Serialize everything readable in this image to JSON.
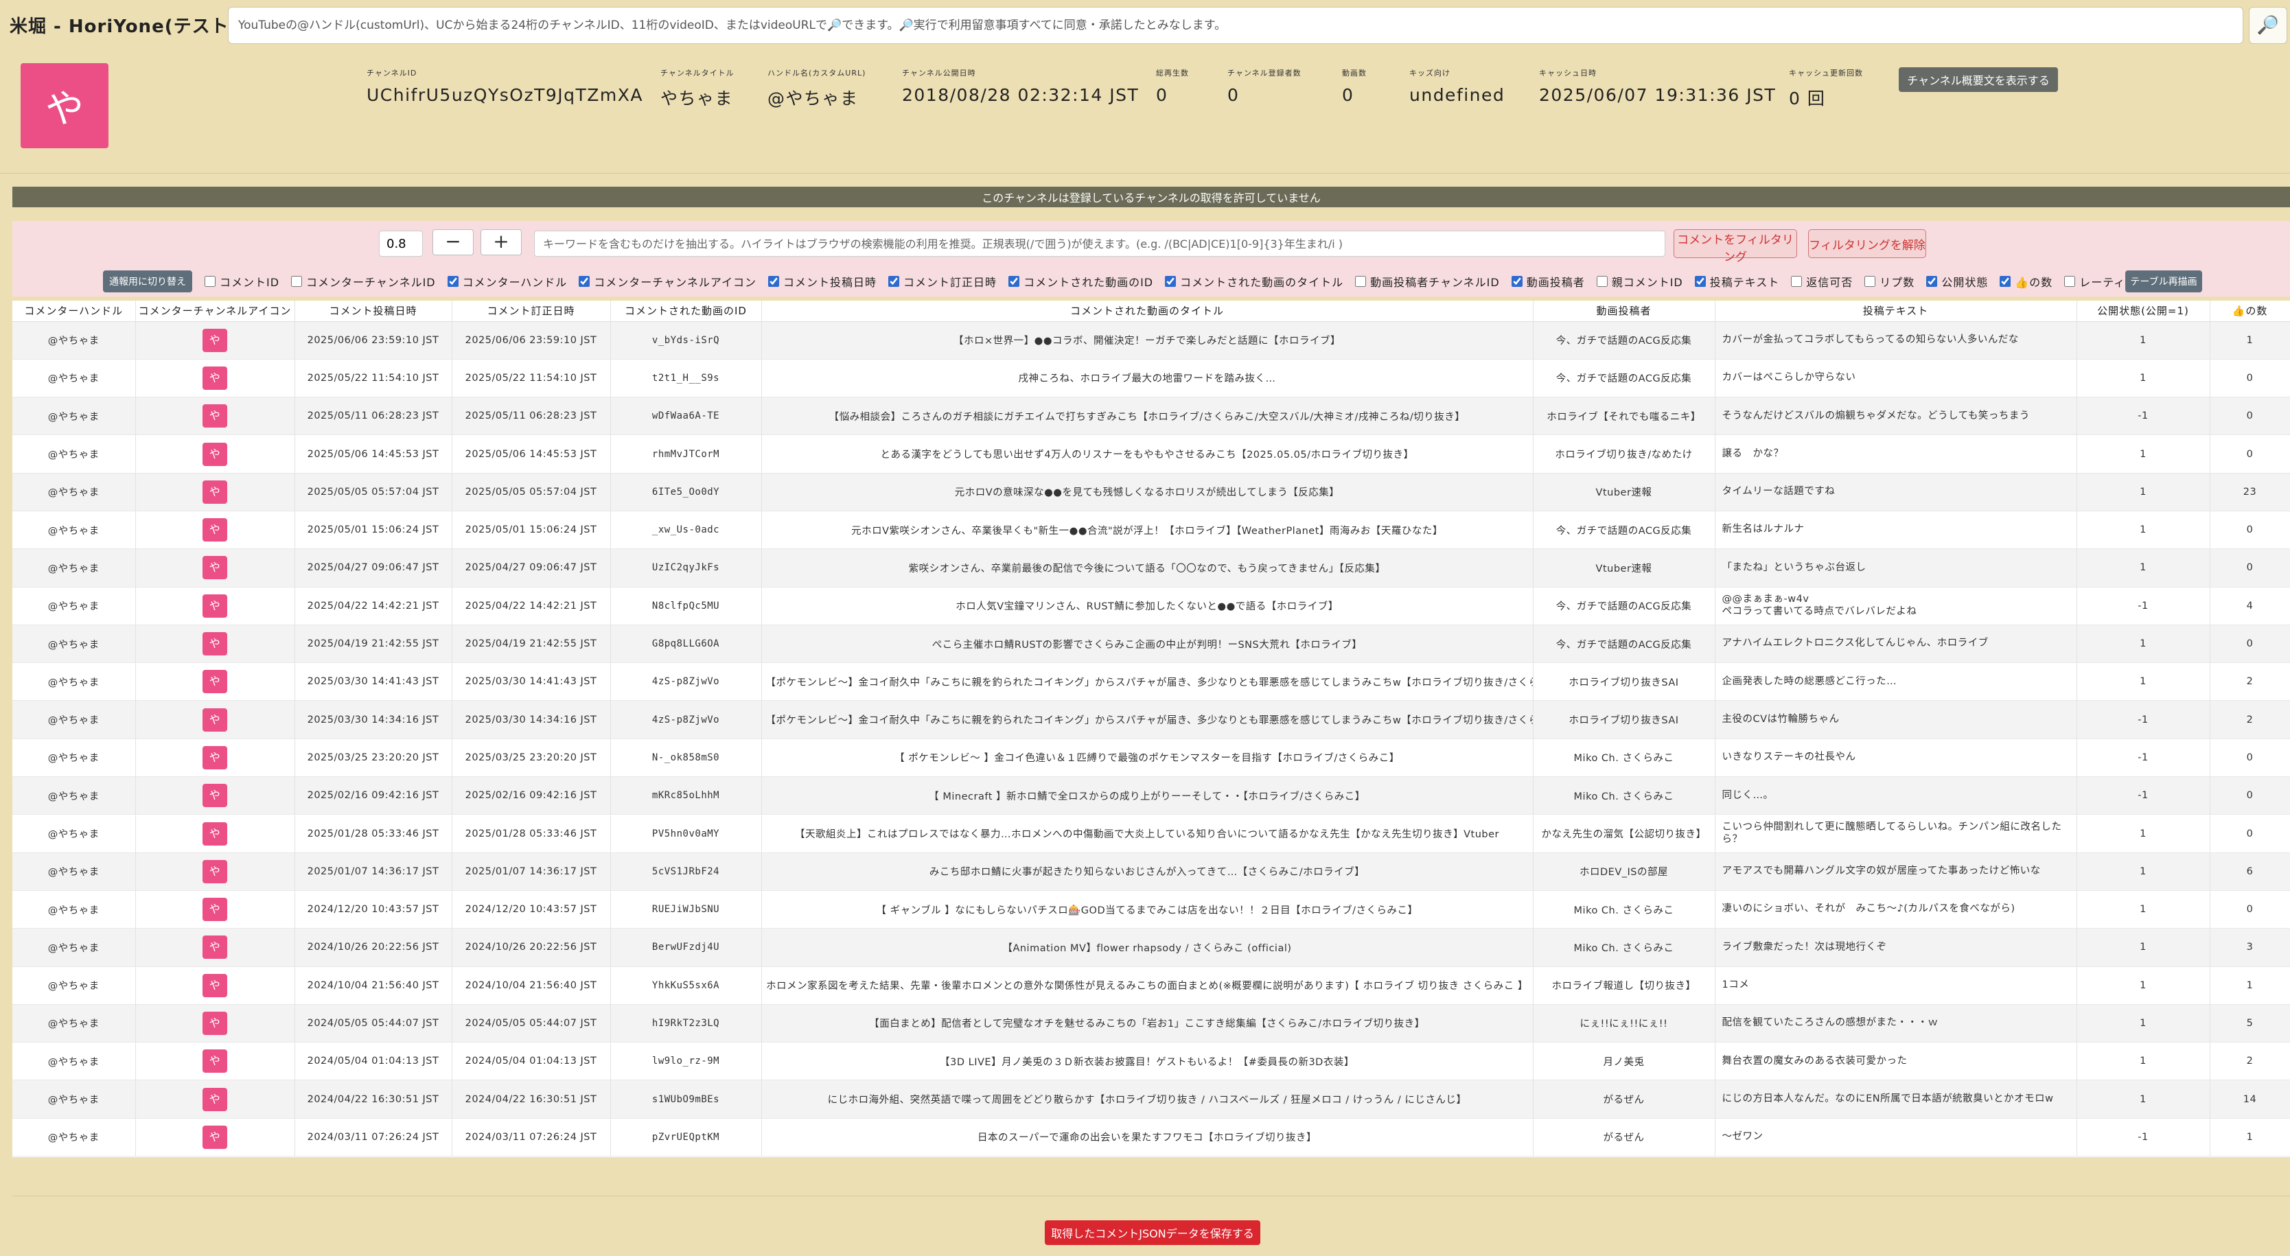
{
  "app": {
    "title": "米堀 - HoriYone(テスト中)",
    "search_placeholder": "YouTubeの@ハンドル(customUrl)、UCから始まる24桁のチャンネルID、11桁のvideoID、またはvideoURLで🔎できます。🔎実行で利用留意事項すべてに同意・承諾したとみなします。",
    "search_icon": "🔎"
  },
  "channel": {
    "avatar_char": "や",
    "fields": [
      {
        "label": "チャンネルID",
        "value": "UChifrU5uzQYsOzT9JqTZmXA"
      },
      {
        "label": "チャンネルタイトル",
        "value": "やちゃま"
      },
      {
        "label": "ハンドル名(カスタムURL)",
        "value": "@やちゃま"
      },
      {
        "label": "チャンネル公開日時",
        "value": "2018/08/28 02:32:14 JST"
      },
      {
        "label": "総再生数",
        "value": "0"
      },
      {
        "label": "チャンネル登録者数",
        "value": "0"
      },
      {
        "label": "動画数",
        "value": "0"
      },
      {
        "label": "キッズ向け",
        "value": "undefined"
      },
      {
        "label": "キャッシュ日時",
        "value": "2025/06/07 19:31:36 JST"
      },
      {
        "label": "キャッシュ更新回数",
        "value": "0 回"
      }
    ],
    "summary_button": "チャンネル概要文を表示する"
  },
  "notice": "このチャンネルは登録しているチャンネルの取得を許可していません",
  "filter": {
    "threshold": "0.8",
    "minus": "−",
    "plus": "+",
    "keyword_placeholder": "キーワードを含むものだけを抽出する。ハイライトはブラウザの検索機能の利用を推奨。正規表現(/で囲う)が使えます。(e.g. /(BC|AD|CE)1[0-9]{3}年生まれ/i )",
    "apply_button": "コメントをフィルタリング",
    "clear_button": "フィルタリングを解除",
    "toggle_button": "通報用に切り替え",
    "redraw_button": "テーブル再描画",
    "columns": [
      {
        "label": "コメントID",
        "checked": false
      },
      {
        "label": "コメンターチャンネルID",
        "checked": false
      },
      {
        "label": "コメンターハンドル",
        "checked": true
      },
      {
        "label": "コメンターチャンネルアイコン",
        "checked": true
      },
      {
        "label": "コメント投稿日時",
        "checked": true
      },
      {
        "label": "コメント訂正日時",
        "checked": true
      },
      {
        "label": "コメントされた動画のID",
        "checked": true
      },
      {
        "label": "コメントされた動画のタイトル",
        "checked": true
      },
      {
        "label": "動画投稿者チャンネルID",
        "checked": false
      },
      {
        "label": "動画投稿者",
        "checked": true
      },
      {
        "label": "親コメントID",
        "checked": false
      },
      {
        "label": "投稿テキスト",
        "checked": true
      },
      {
        "label": "返信可否",
        "checked": false
      },
      {
        "label": "リプ数",
        "checked": false
      },
      {
        "label": "公開状態",
        "checked": true
      },
      {
        "label": "👍の数",
        "checked": true
      },
      {
        "label": "レーティング",
        "checked": false
      }
    ]
  },
  "table": {
    "headers": [
      "コメンターハンドル",
      "コメンターチャンネルアイコン",
      "コメント投稿日時",
      "コメント訂正日時",
      "コメントされた動画のID",
      "コメントされた動画のタイトル",
      "動画投稿者",
      "投稿テキスト",
      "公開状態(公開=1)",
      "👍の数"
    ],
    "icon_char": "や",
    "rows": [
      [
        "@やちゃま",
        "2025/06/06 23:59:10 JST",
        "2025/06/06 23:59:10 JST",
        "v_bYds-iSrQ",
        "【ホロ×世界一】●●コラボ、開催決定！ーガチで楽しみだと話題に【ホロライブ】",
        "今、ガチで話題のACG反応集",
        "カバーが金払ってコラボしてもらってるの知らない人多いんだな",
        "1",
        "1"
      ],
      [
        "@やちゃま",
        "2025/05/22 11:54:10 JST",
        "2025/05/22 11:54:10 JST",
        "t2t1_H__S9s",
        "戌神ころね、ホロライブ最大の地雷ワードを踏み抜く…",
        "今、ガチで話題のACG反応集",
        "カバーはぺこらしか守らない",
        "1",
        "0"
      ],
      [
        "@やちゃま",
        "2025/05/11 06:28:23 JST",
        "2025/05/11 06:28:23 JST",
        "wDfWaa6A-TE",
        "【悩み相談会】ころさんのガチ相談にガチエイムで打ちすぎみこち【ホロライブ/さくらみこ/大空スバル/大神ミオ/戌神ころね/切り抜き】",
        "ホロライブ【それでも嗤るニキ】",
        "そうなんだけどスバルの煽観ちゃダメだな。どうしても笑っちまう",
        "-1",
        "0"
      ],
      [
        "@やちゃま",
        "2025/05/06 14:45:53 JST",
        "2025/05/06 14:45:53 JST",
        "rhmMvJTCorM",
        "とある漢字をどうしても思い出せず4万人のリスナーをもやもやさせるみこち【2025.05.05/ホロライブ切り抜き】",
        "ホロライブ切り抜き/なめたけ",
        "譲る　かな？",
        "1",
        "0"
      ],
      [
        "@やちゃま",
        "2025/05/05 05:57:04 JST",
        "2025/05/05 05:57:04 JST",
        "6ITe5_Oo0dY",
        "元ホロVの意味深な●●を見ても残憾しくなるホロリスが続出してしまう【反応集】",
        "Vtuber速報",
        "タイムリーな話題ですね",
        "1",
        "23"
      ],
      [
        "@やちゃま",
        "2025/05/01 15:06:24 JST",
        "2025/05/01 15:06:24 JST",
        "_xw_Us-0adc",
        "元ホロV紫咲シオンさん、卒業後早くも\"新生一●●合流\"説が浮上！【ホロライブ】【WeatherPlanet】雨海みお【天羅ひなた】",
        "今、ガチで話題のACG反応集",
        "新生名はルナルナ",
        "1",
        "0"
      ],
      [
        "@やちゃま",
        "2025/04/27 09:06:47 JST",
        "2025/04/27 09:06:47 JST",
        "UzIC2qyJkFs",
        "紫咲シオンさん、卒業前最後の配信で今後について語る「〇〇なので、もう戻ってきません」【反応集】",
        "Vtuber速報",
        "「またね」というちゃぶ台返し",
        "1",
        "0"
      ],
      [
        "@やちゃま",
        "2025/04/22 14:42:21 JST",
        "2025/04/22 14:42:21 JST",
        "N8clfpQc5MU",
        "ホロ人気V宝鐘マリンさん、RUST鯖に参加したくないと●●で語る【ホロライブ】",
        "今、ガチで話題のACG反応集",
        "@@まぁまぁ-w4v\nペコラって書いてる時点でバレバレだよね",
        "-1",
        "4"
      ],
      [
        "@やちゃま",
        "2025/04/19 21:42:55 JST",
        "2025/04/19 21:42:55 JST",
        "G8pq8LLG6OA",
        "ぺこら主催ホロ鯖RUSTの影響でさくらみこ企画の中止が判明！ーSNS大荒れ【ホロライブ】",
        "今、ガチで話題のACG反応集",
        "アナハイムエレクトロニクス化してんじゃん、ホロライブ",
        "1",
        "0"
      ],
      [
        "@やちゃま",
        "2025/03/30 14:41:43 JST",
        "2025/03/30 14:41:43 JST",
        "4zS-p8ZjwVo",
        "【ポケモンレビ〜】金コイ耐久中「みこちに親を釣られたコイキング」からスパチャが届き、多少なりとも罪悪感を感じてしまうみこちw【ホロライブ切り抜き/さくらみこ】",
        "ホロライブ切り抜きSAI",
        "企画発表した時の総悪感どこ行った…",
        "1",
        "2"
      ],
      [
        "@やちゃま",
        "2025/03/30 14:34:16 JST",
        "2025/03/30 14:34:16 JST",
        "4zS-p8ZjwVo",
        "【ポケモンレビ〜】金コイ耐久中「みこちに親を釣られたコイキング」からスパチャが届き、多少なりとも罪悪感を感じてしまうみこちw【ホロライブ切り抜き/さくらみこ】",
        "ホロライブ切り抜きSAI",
        "主役のCVは竹輪勝ちゃん",
        "-1",
        "2"
      ],
      [
        "@やちゃま",
        "2025/03/25 23:20:20 JST",
        "2025/03/25 23:20:20 JST",
        "N-_ok858mS0",
        "【 ポケモンレビ〜 】金コイ色違い＆１匹縛りで最強のポケモンマスターを目指す【ホロライブ/さくらみこ】",
        "Miko Ch. さくらみこ",
        "いきなりステーキの社長やん",
        "-1",
        "0"
      ],
      [
        "@やちゃま",
        "2025/02/16 09:42:16 JST",
        "2025/02/16 09:42:16 JST",
        "mKRc85oLhhM",
        "【 Minecraft 】新ホロ鯖で全ロスからの成り上がりーーそして・・【ホロライブ/さくらみこ】",
        "Miko Ch. さくらみこ",
        "同じく…。",
        "-1",
        "0"
      ],
      [
        "@やちゃま",
        "2025/01/28 05:33:46 JST",
        "2025/01/28 05:33:46 JST",
        "PV5hn0v0aMY",
        "【天歌組炎上】これはプロレスではなく暴力…ホロメンへの中傷動画で大炎上している知り合いについて語るかなえ先生【かなえ先生切り抜き】Vtuber",
        "かなえ先生の溜気【公認切り抜き】",
        "こいつら仲間割れして更に醜態晒してるらしいね。チンパン組に改名したら？",
        "1",
        "0"
      ],
      [
        "@やちゃま",
        "2025/01/07 14:36:17 JST",
        "2025/01/07 14:36:17 JST",
        "5cVS1JRbF24",
        "みこち邸ホロ鯖に火事が起きたり知らないおじさんが入ってきて…【さくらみこ/ホロライブ】",
        "ホロDEV_ISの部屋",
        "アモアスでも開幕ハングル文字の奴が居座ってた事あったけど怖いな",
        "1",
        "6"
      ],
      [
        "@やちゃま",
        "2024/12/20 10:43:57 JST",
        "2024/12/20 10:43:57 JST",
        "RUEJiWJbSNU",
        "【 ギャンブル 】なにもしらないパチスロ🎰GOD当てるまでみこは店を出ない！！２日目【ホロライブ/さくらみこ】",
        "Miko Ch. さくらみこ",
        "凄いのにショボい、それが　みこち～♪(カルパスを食べながら)",
        "1",
        "0"
      ],
      [
        "@やちゃま",
        "2024/10/26 20:22:56 JST",
        "2024/10/26 20:22:56 JST",
        "BerwUFzdj4U",
        "【Animation MV】flower rhapsody / さくらみこ (official)",
        "Miko Ch. さくらみこ",
        "ライブ敷衆だった！次は現地行くぞ",
        "1",
        "3"
      ],
      [
        "@やちゃま",
        "2024/10/04 21:56:40 JST",
        "2024/10/04 21:56:40 JST",
        "YhkKuS5sx6A",
        "ホロメン家系図を考えた結果、先輩・後輩ホロメンとの意外な関係性が見えるみこちの面白まとめ(※概要欄に説明があります)【 ホロライブ 切り抜き さくらみこ 】",
        "ホロライブ報道し【切り抜き】",
        "1コメ",
        "1",
        "1"
      ],
      [
        "@やちゃま",
        "2024/05/05 05:44:07 JST",
        "2024/05/05 05:44:07 JST",
        "hI9RkT2z3LQ",
        "【面白まとめ】配信者として完璧なオチを魅せるみこちの「岩お1」ここすき総集編【さくらみこ/ホロライブ切り抜き】",
        "にぇ!!にぇ!!にぇ!!",
        "配信を観ていたころさんの感想がまた・・・ｗ",
        "1",
        "5"
      ],
      [
        "@やちゃま",
        "2024/05/04 01:04:13 JST",
        "2024/05/04 01:04:13 JST",
        "lw9lo_rz-9M",
        "【3D LIVE】月ノ美兎の３Ｄ新衣装お披露目！ゲストもいるよ！【#委員長の新3D衣装】",
        "月ノ美兎",
        "舞台衣置の魔女みのある衣装可愛かった",
        "1",
        "2"
      ],
      [
        "@やちゃま",
        "2024/04/22 16:30:51 JST",
        "2024/04/22 16:30:51 JST",
        "s1WUbO9mBEs",
        "にじホロ海外組、突然英語で喋って周囲をどどり散らかす【ホロライブ切り抜き / ハコスベールズ / 狂屋メロコ / けっうん / にじさんじ】",
        "がるぜん",
        "にじの方日本人なんだ。なのにEN所属で日本語が統散臭いとかオモロw",
        "1",
        "14"
      ],
      [
        "@やちゃま",
        "2024/03/11 07:26:24 JST",
        "2024/03/11 07:26:24 JST",
        "pZvrUEQptKM",
        "日本のスーパーで運命の出会いを果たすフワモコ【ホロライブ切り抜き】",
        "がるぜん",
        "～ゼワン",
        "-1",
        "1"
      ]
    ]
  },
  "save_button": "取得したコメントJSONデータを保存する"
}
